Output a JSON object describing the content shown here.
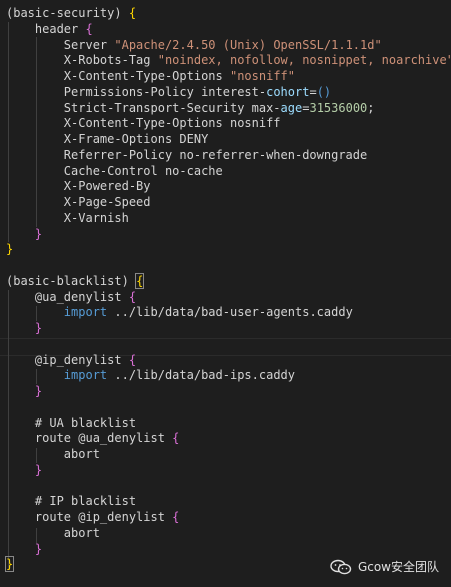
{
  "lines": [
    {
      "i": 0,
      "parts": [
        [
          "(",
          "paren"
        ],
        [
          "basic-security",
          "name"
        ],
        [
          ")",
          "paren"
        ],
        [
          " ",
          ""
        ],
        [
          "{",
          "brace1"
        ]
      ]
    },
    {
      "i": 1,
      "parts": [
        [
          "    header ",
          ""
        ],
        [
          "{",
          "brace2"
        ]
      ]
    },
    {
      "i": 2,
      "parts": [
        [
          "        Server ",
          ""
        ],
        [
          "\"Apache/2.4.50 (Unix) OpenSSL/1.1.1d\"",
          "str"
        ]
      ]
    },
    {
      "i": 3,
      "parts": [
        [
          "        X-Robots-Tag ",
          ""
        ],
        [
          "\"noindex, nofollow, nosnippet, noarchive\"",
          "str"
        ]
      ]
    },
    {
      "i": 4,
      "parts": [
        [
          "        X-Content-Type-Options ",
          ""
        ],
        [
          "\"nosniff\"",
          "str"
        ]
      ]
    },
    {
      "i": 5,
      "parts": [
        [
          "        Permissions-Policy interest-",
          ""
        ],
        [
          "cohort",
          "lightblue"
        ],
        [
          "=",
          "kw"
        ],
        [
          "()",
          "blue"
        ]
      ]
    },
    {
      "i": 6,
      "parts": [
        [
          "        Strict-Transport-Security max-",
          ""
        ],
        [
          "age",
          "lightblue"
        ],
        [
          "=",
          "kw"
        ],
        [
          "31536000",
          "num"
        ],
        [
          ";",
          ""
        ]
      ]
    },
    {
      "i": 7,
      "parts": [
        [
          "        X-Content-Type-Options nosniff",
          ""
        ]
      ]
    },
    {
      "i": 8,
      "parts": [
        [
          "        X-Frame-Options DENY",
          ""
        ]
      ]
    },
    {
      "i": 9,
      "parts": [
        [
          "        Referrer-Policy no-referrer-when-downgrade",
          ""
        ]
      ]
    },
    {
      "i": 10,
      "parts": [
        [
          "        Cache-Control no-cache",
          ""
        ]
      ]
    },
    {
      "i": 11,
      "parts": [
        [
          "        X-Powered-By",
          ""
        ]
      ]
    },
    {
      "i": 12,
      "parts": [
        [
          "        X-Page-Speed",
          ""
        ]
      ]
    },
    {
      "i": 13,
      "parts": [
        [
          "        X-Varnish",
          ""
        ]
      ]
    },
    {
      "i": 14,
      "parts": [
        [
          "    ",
          ""
        ],
        [
          "}",
          "brace2"
        ]
      ]
    },
    {
      "i": 15,
      "parts": [
        [
          "}",
          "brace1"
        ]
      ]
    },
    {
      "i": 16,
      "parts": []
    },
    {
      "i": 17,
      "parts": [
        [
          "(",
          "paren"
        ],
        [
          "basic-blacklist",
          "name"
        ],
        [
          ")",
          "paren"
        ],
        [
          " ",
          ""
        ],
        [
          "{",
          "brace1 hl-brace"
        ]
      ]
    },
    {
      "i": 18,
      "parts": [
        [
          "    @ua_denylist ",
          ""
        ],
        [
          "{",
          "brace2"
        ]
      ]
    },
    {
      "i": 19,
      "parts": [
        [
          "        ",
          ""
        ],
        [
          "import",
          "blue"
        ],
        [
          " ../lib/data/bad-user-agents.caddy",
          ""
        ]
      ]
    },
    {
      "i": 20,
      "parts": [
        [
          "    ",
          ""
        ],
        [
          "}",
          "brace2"
        ]
      ]
    },
    {
      "i": 21,
      "parts": []
    },
    {
      "i": 22,
      "parts": [
        [
          "    @ip_denylist ",
          ""
        ],
        [
          "{",
          "brace2"
        ]
      ]
    },
    {
      "i": 23,
      "parts": [
        [
          "        ",
          ""
        ],
        [
          "import",
          "blue"
        ],
        [
          " ../lib/data/bad-ips.caddy",
          ""
        ]
      ]
    },
    {
      "i": 24,
      "parts": [
        [
          "    ",
          ""
        ],
        [
          "}",
          "brace2"
        ]
      ]
    },
    {
      "i": 25,
      "parts": []
    },
    {
      "i": 26,
      "parts": [
        [
          "    # UA blacklist",
          ""
        ]
      ]
    },
    {
      "i": 27,
      "parts": [
        [
          "    route @ua_denylist ",
          ""
        ],
        [
          "{",
          "brace2"
        ]
      ]
    },
    {
      "i": 28,
      "parts": [
        [
          "        abort",
          ""
        ]
      ]
    },
    {
      "i": 29,
      "parts": [
        [
          "    ",
          ""
        ],
        [
          "}",
          "brace2"
        ]
      ]
    },
    {
      "i": 30,
      "parts": []
    },
    {
      "i": 31,
      "parts": [
        [
          "    # IP blacklist",
          ""
        ]
      ]
    },
    {
      "i": 32,
      "parts": [
        [
          "    route @ip_denylist ",
          ""
        ],
        [
          "{",
          "brace2"
        ]
      ]
    },
    {
      "i": 33,
      "parts": [
        [
          "        abort",
          ""
        ]
      ]
    },
    {
      "i": 34,
      "parts": [
        [
          "    ",
          ""
        ],
        [
          "}",
          "brace2"
        ]
      ]
    },
    {
      "i": 35,
      "parts": [
        [
          "}",
          "brace1 hl-brace"
        ]
      ]
    }
  ],
  "watermark": {
    "icon": "wechat-icon",
    "text": "Gcow安全团队"
  },
  "colors": {
    "background": "#1e1e1e",
    "string": "#ce9178",
    "keyword": "#569cd6",
    "brace_outer": "#ffd700",
    "brace_inner": "#da70d6"
  }
}
